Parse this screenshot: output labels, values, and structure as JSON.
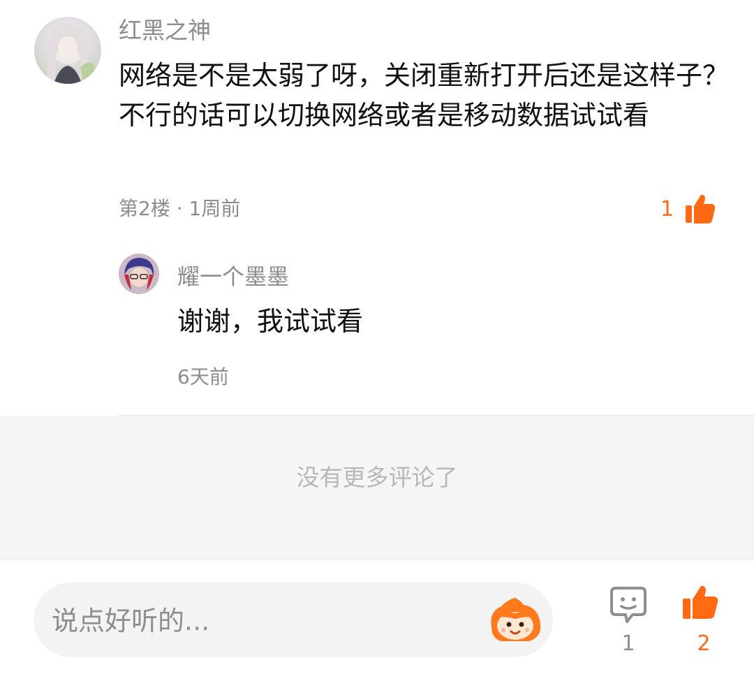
{
  "comment": {
    "username": "红黑之神",
    "text": "网络是不是太弱了呀，关闭重新打开后还是这样子？不行的话可以切换网络或者是移动数据试试看",
    "floor_time": "第2楼 · 1周前",
    "like_count": "1"
  },
  "reply": {
    "username": "耀一个墨墨",
    "text": "谢谢，我试试看",
    "time": "6天前"
  },
  "footer": {
    "no_more": "没有更多评论了"
  },
  "bottom_bar": {
    "input_placeholder": "说点好听的...",
    "comment_count": "1",
    "like_count": "2"
  },
  "colors": {
    "accent": "#ff6a13",
    "meta_gray": "#8c8c8c"
  },
  "icons": [
    "avatar",
    "thumbs-up-icon",
    "comment-bubble-icon",
    "mascot-emoji-icon"
  ]
}
